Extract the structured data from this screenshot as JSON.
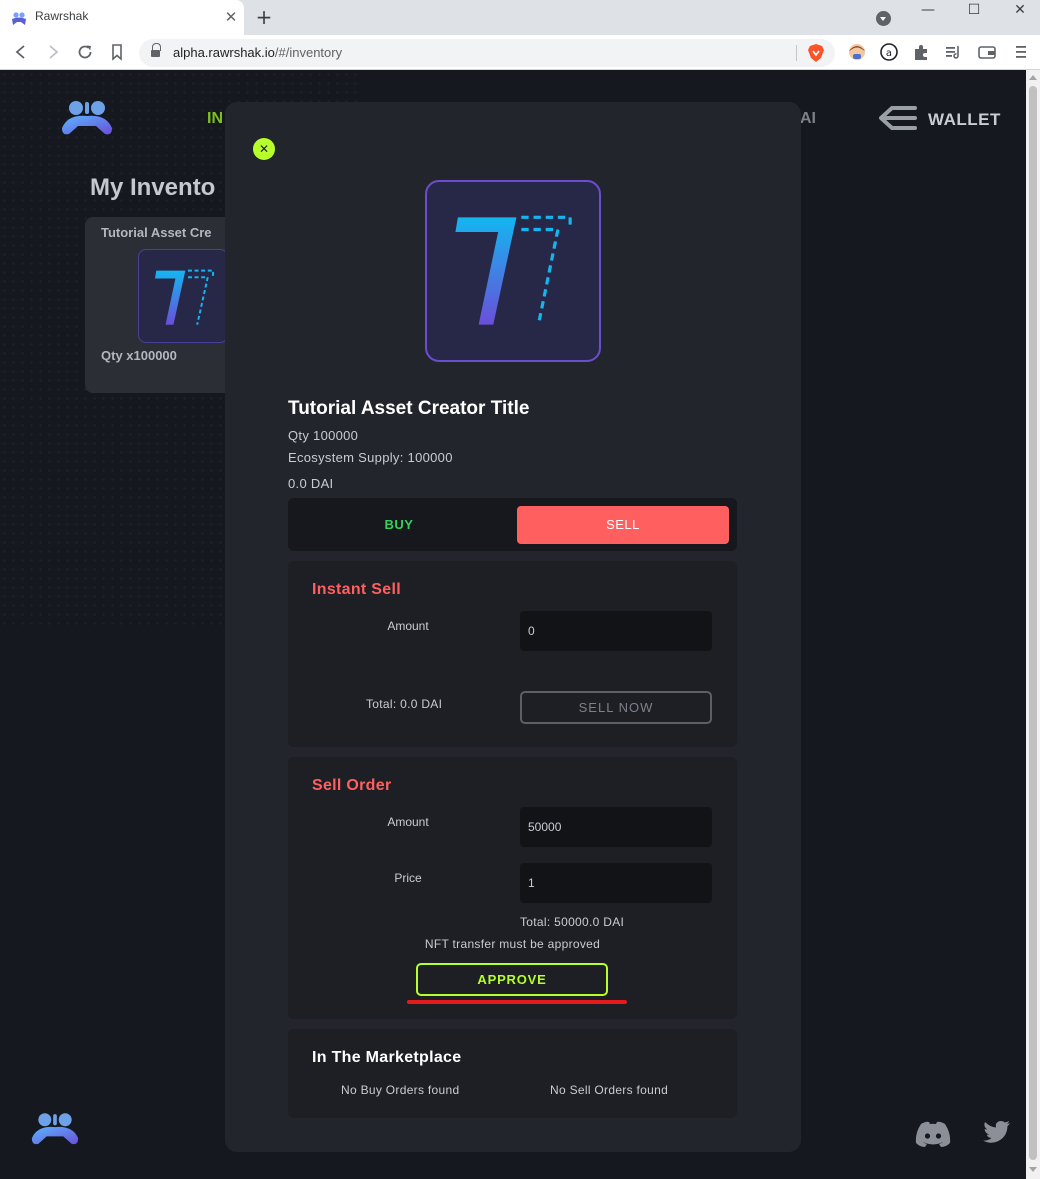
{
  "browser": {
    "tab_title": "Rawrshak",
    "tab_close": "✕",
    "new_tab": "+",
    "url_host": "alpha.rawrshak.io",
    "url_path": "/#/inventory",
    "win_minimize": "—",
    "win_maximize": "☐",
    "win_close": "✕"
  },
  "nav": {
    "active_partial": "IN",
    "right_partial": "AI",
    "wallet_label": "WALLET"
  },
  "inventory": {
    "title": "My Invento",
    "card_title": "Tutorial Asset Cre",
    "card_qty": "Qty x100000"
  },
  "modal": {
    "close_symbol": "✕",
    "asset_title": "Tutorial Asset Creator Title",
    "qty": "Qty 100000",
    "supply": "Ecosystem Supply: 100000",
    "price": "0.0 DAI",
    "tabs": {
      "buy": "BUY",
      "sell": "SELL"
    },
    "instant_sell": {
      "title": "Instant Sell",
      "amount_label": "Amount",
      "amount_value": "0",
      "total": "Total: 0.0 DAI",
      "button": "SELL NOW"
    },
    "sell_order": {
      "title": "Sell Order",
      "amount_label": "Amount",
      "amount_value": "50000",
      "price_label": "Price",
      "price_value": "1",
      "total": "Total: 50000.0 DAI",
      "notice": "NFT transfer must be approved",
      "button": "APPROVE"
    },
    "marketplace": {
      "title": "In The Marketplace",
      "buy_orders": "No Buy Orders found",
      "sell_orders": "No Sell Orders found"
    }
  },
  "colors": {
    "accent_green": "#b6ff2a",
    "sell_red": "#ff5f5f",
    "buy_green": "#36d05a",
    "annotation_red": "#e61a1a"
  }
}
